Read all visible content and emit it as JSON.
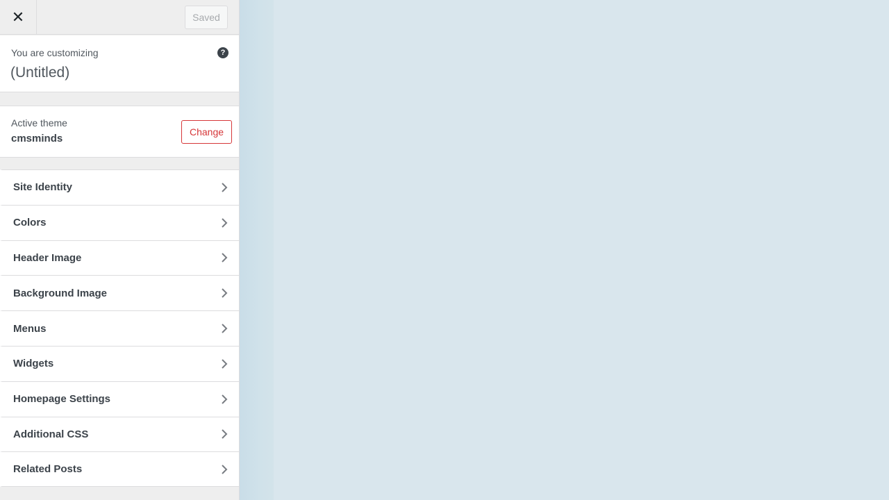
{
  "header": {
    "close_label": "✕",
    "saved_label": "Saved"
  },
  "info": {
    "pre_title": "You are customizing",
    "title": "(Untitled)",
    "help_label": "?"
  },
  "theme": {
    "label": "Active theme",
    "name": "cmsminds",
    "change_label": "Change"
  },
  "sections": [
    {
      "label": "Site Identity"
    },
    {
      "label": "Colors"
    },
    {
      "label": "Header Image"
    },
    {
      "label": "Background Image"
    },
    {
      "label": "Menus"
    },
    {
      "label": "Widgets"
    },
    {
      "label": "Homepage Settings"
    },
    {
      "label": "Additional CSS"
    },
    {
      "label": "Related Posts"
    }
  ],
  "icons": {
    "close": "close-icon",
    "help": "help-icon",
    "chevron": "chevron-right-icon"
  },
  "colors": {
    "accent_red": "#d63638",
    "preview_bg": "#d9e6ed"
  }
}
